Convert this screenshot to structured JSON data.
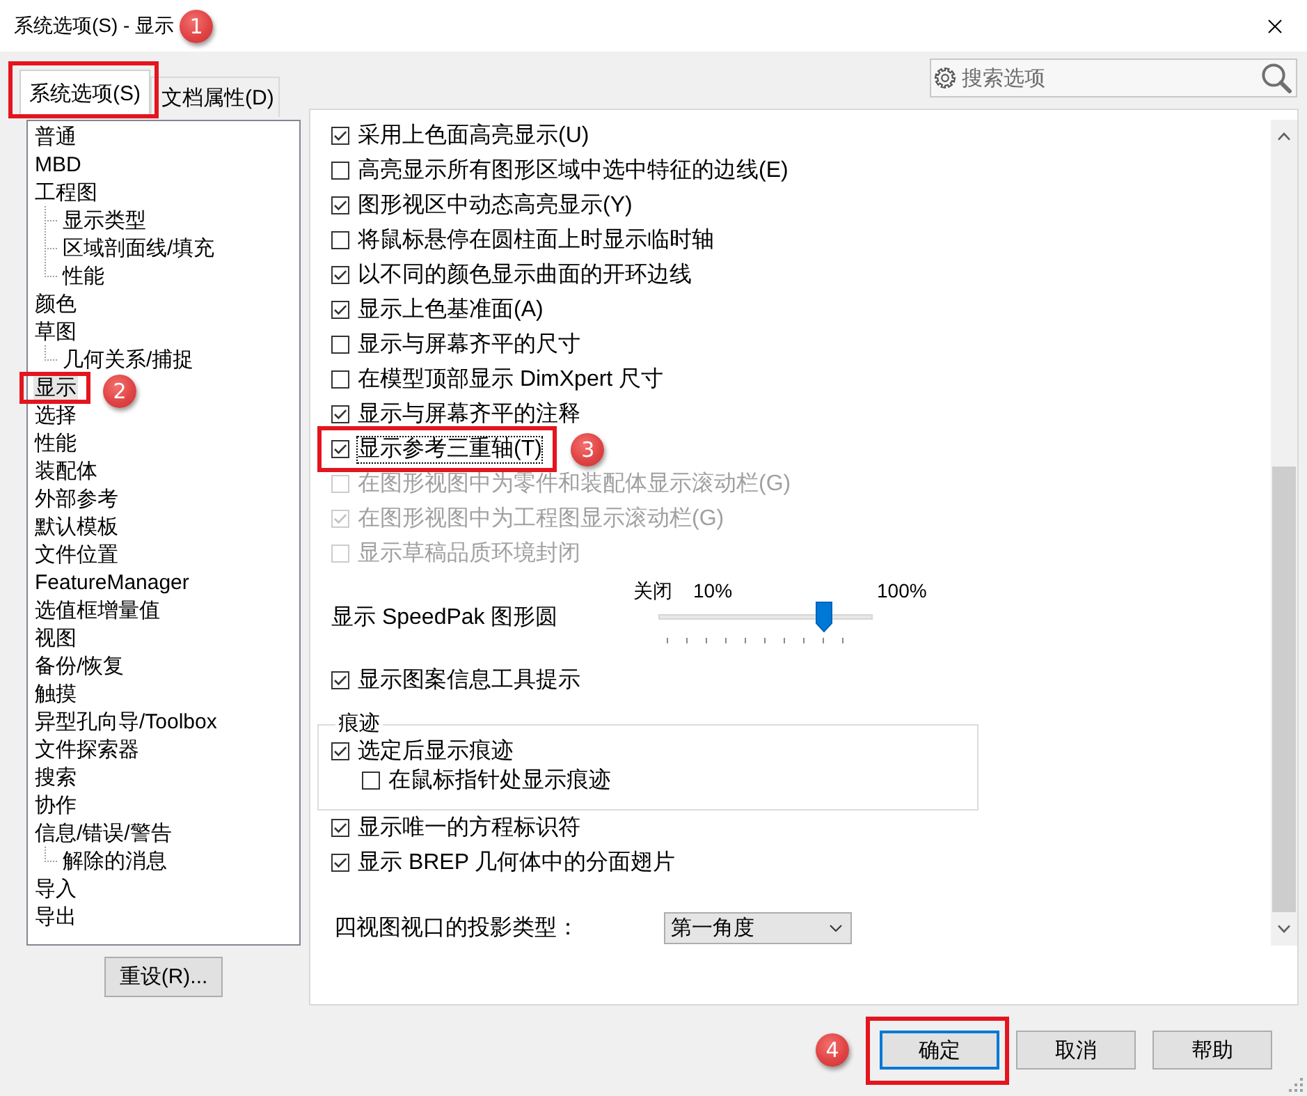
{
  "window": {
    "title": "系统选项(S) - 显示"
  },
  "tabs": [
    {
      "label": "系统选项(S)",
      "selected": true,
      "callout": "1"
    },
    {
      "label": "文档属性(D)",
      "selected": false
    }
  ],
  "search": {
    "placeholder": "搜索选项"
  },
  "tree": {
    "items": [
      {
        "label": "普通",
        "selected": false
      },
      {
        "label": "MBD",
        "selected": false
      },
      {
        "label": "工程图",
        "selected": false,
        "children": [
          {
            "label": "显示类型",
            "selected": false
          },
          {
            "label": "区域剖面线/填充",
            "selected": false
          },
          {
            "label": "性能",
            "selected": false
          }
        ]
      },
      {
        "label": "颜色",
        "selected": false
      },
      {
        "label": "草图",
        "selected": false,
        "children": [
          {
            "label": "几何关系/捕捉",
            "selected": false
          }
        ]
      },
      {
        "label": "显示",
        "selected": true,
        "callout": "2"
      },
      {
        "label": "选择",
        "selected": false
      },
      {
        "label": "性能",
        "selected": false
      },
      {
        "label": "装配体",
        "selected": false
      },
      {
        "label": "外部参考",
        "selected": false
      },
      {
        "label": "默认模板",
        "selected": false
      },
      {
        "label": "文件位置",
        "selected": false
      },
      {
        "label": "FeatureManager",
        "selected": false
      },
      {
        "label": "选值框增量值",
        "selected": false
      },
      {
        "label": "视图",
        "selected": false
      },
      {
        "label": "备份/恢复",
        "selected": false
      },
      {
        "label": "触摸",
        "selected": false
      },
      {
        "label": "异型孔向导/Toolbox",
        "selected": false
      },
      {
        "label": "文件探索器",
        "selected": false
      },
      {
        "label": "搜索",
        "selected": false
      },
      {
        "label": "协作",
        "selected": false
      },
      {
        "label": "信息/错误/警告",
        "selected": false,
        "children": [
          {
            "label": "解除的消息",
            "selected": false
          }
        ]
      },
      {
        "label": "导入",
        "selected": false
      },
      {
        "label": "导出",
        "selected": false
      }
    ]
  },
  "reset_button": {
    "label": "重设(R)..."
  },
  "options": [
    {
      "kind": "checkbox",
      "label": "采用上色面高亮显示(U)",
      "checked": true,
      "disabled": false,
      "focused": false
    },
    {
      "kind": "checkbox",
      "label": "高亮显示所有图形区域中选中特征的边线(E)",
      "checked": false,
      "disabled": false,
      "focused": false
    },
    {
      "kind": "checkbox",
      "label": "图形视区中动态高亮显示(Y)",
      "checked": true,
      "disabled": false,
      "focused": false
    },
    {
      "kind": "checkbox",
      "label": "将鼠标悬停在圆柱面上时显示临时轴",
      "checked": false,
      "disabled": false,
      "focused": false
    },
    {
      "kind": "checkbox",
      "label": "以不同的颜色显示曲面的开环边线",
      "checked": true,
      "disabled": false,
      "focused": false
    },
    {
      "kind": "checkbox",
      "label": "显示上色基准面(A)",
      "checked": true,
      "disabled": false,
      "focused": false
    },
    {
      "kind": "checkbox",
      "label": "显示与屏幕齐平的尺寸",
      "checked": false,
      "disabled": false,
      "focused": false
    },
    {
      "kind": "checkbox",
      "label": "在模型顶部显示 DimXpert 尺寸",
      "checked": false,
      "disabled": false,
      "focused": false
    },
    {
      "kind": "checkbox",
      "label": "显示与屏幕齐平的注释",
      "checked": true,
      "disabled": false,
      "focused": false
    },
    {
      "kind": "checkbox",
      "label": "显示参考三重轴(T)",
      "checked": true,
      "disabled": false,
      "focused": true,
      "callout": "3"
    },
    {
      "kind": "checkbox",
      "label": "在图形视图中为零件和装配体显示滚动栏(G)",
      "checked": false,
      "disabled": true,
      "focused": false
    },
    {
      "kind": "checkbox",
      "label": "在图形视图中为工程图显示滚动栏(G)",
      "checked": true,
      "disabled": true,
      "focused": false
    },
    {
      "kind": "checkbox",
      "label": "显示草稿品质环境封闭",
      "checked": false,
      "disabled": true,
      "focused": false
    },
    {
      "kind": "slider",
      "label": "显示 SpeedPak 图形圆",
      "scale_labels": [
        "关闭",
        "10%",
        "100%"
      ],
      "level": 0.8
    },
    {
      "kind": "checkbox",
      "label": "显示图案信息工具提示",
      "checked": true,
      "disabled": false,
      "focused": false
    },
    {
      "kind": "group",
      "title": "痕迹",
      "children": [
        {
          "kind": "checkbox",
          "label": "选定后显示痕迹",
          "checked": true,
          "disabled": false,
          "focused": false,
          "children": [
            {
              "kind": "checkbox",
              "label": "在鼠标指针处显示痕迹",
              "checked": false,
              "disabled": false,
              "focused": false
            }
          ]
        }
      ]
    },
    {
      "kind": "checkbox",
      "label": "显示唯一的方程标识符",
      "checked": true,
      "disabled": false,
      "focused": false
    },
    {
      "kind": "checkbox",
      "label": "显示 BREP 几何体中的分面翅片",
      "checked": true,
      "disabled": false,
      "focused": false
    },
    {
      "kind": "dropdown",
      "label": "四视图视口的投影类型：",
      "value": "第一角度"
    }
  ],
  "buttons": [
    {
      "label": "确定",
      "default": true,
      "callout": "4"
    },
    {
      "label": "取消",
      "default": false
    },
    {
      "label": "帮助",
      "default": false
    }
  ]
}
